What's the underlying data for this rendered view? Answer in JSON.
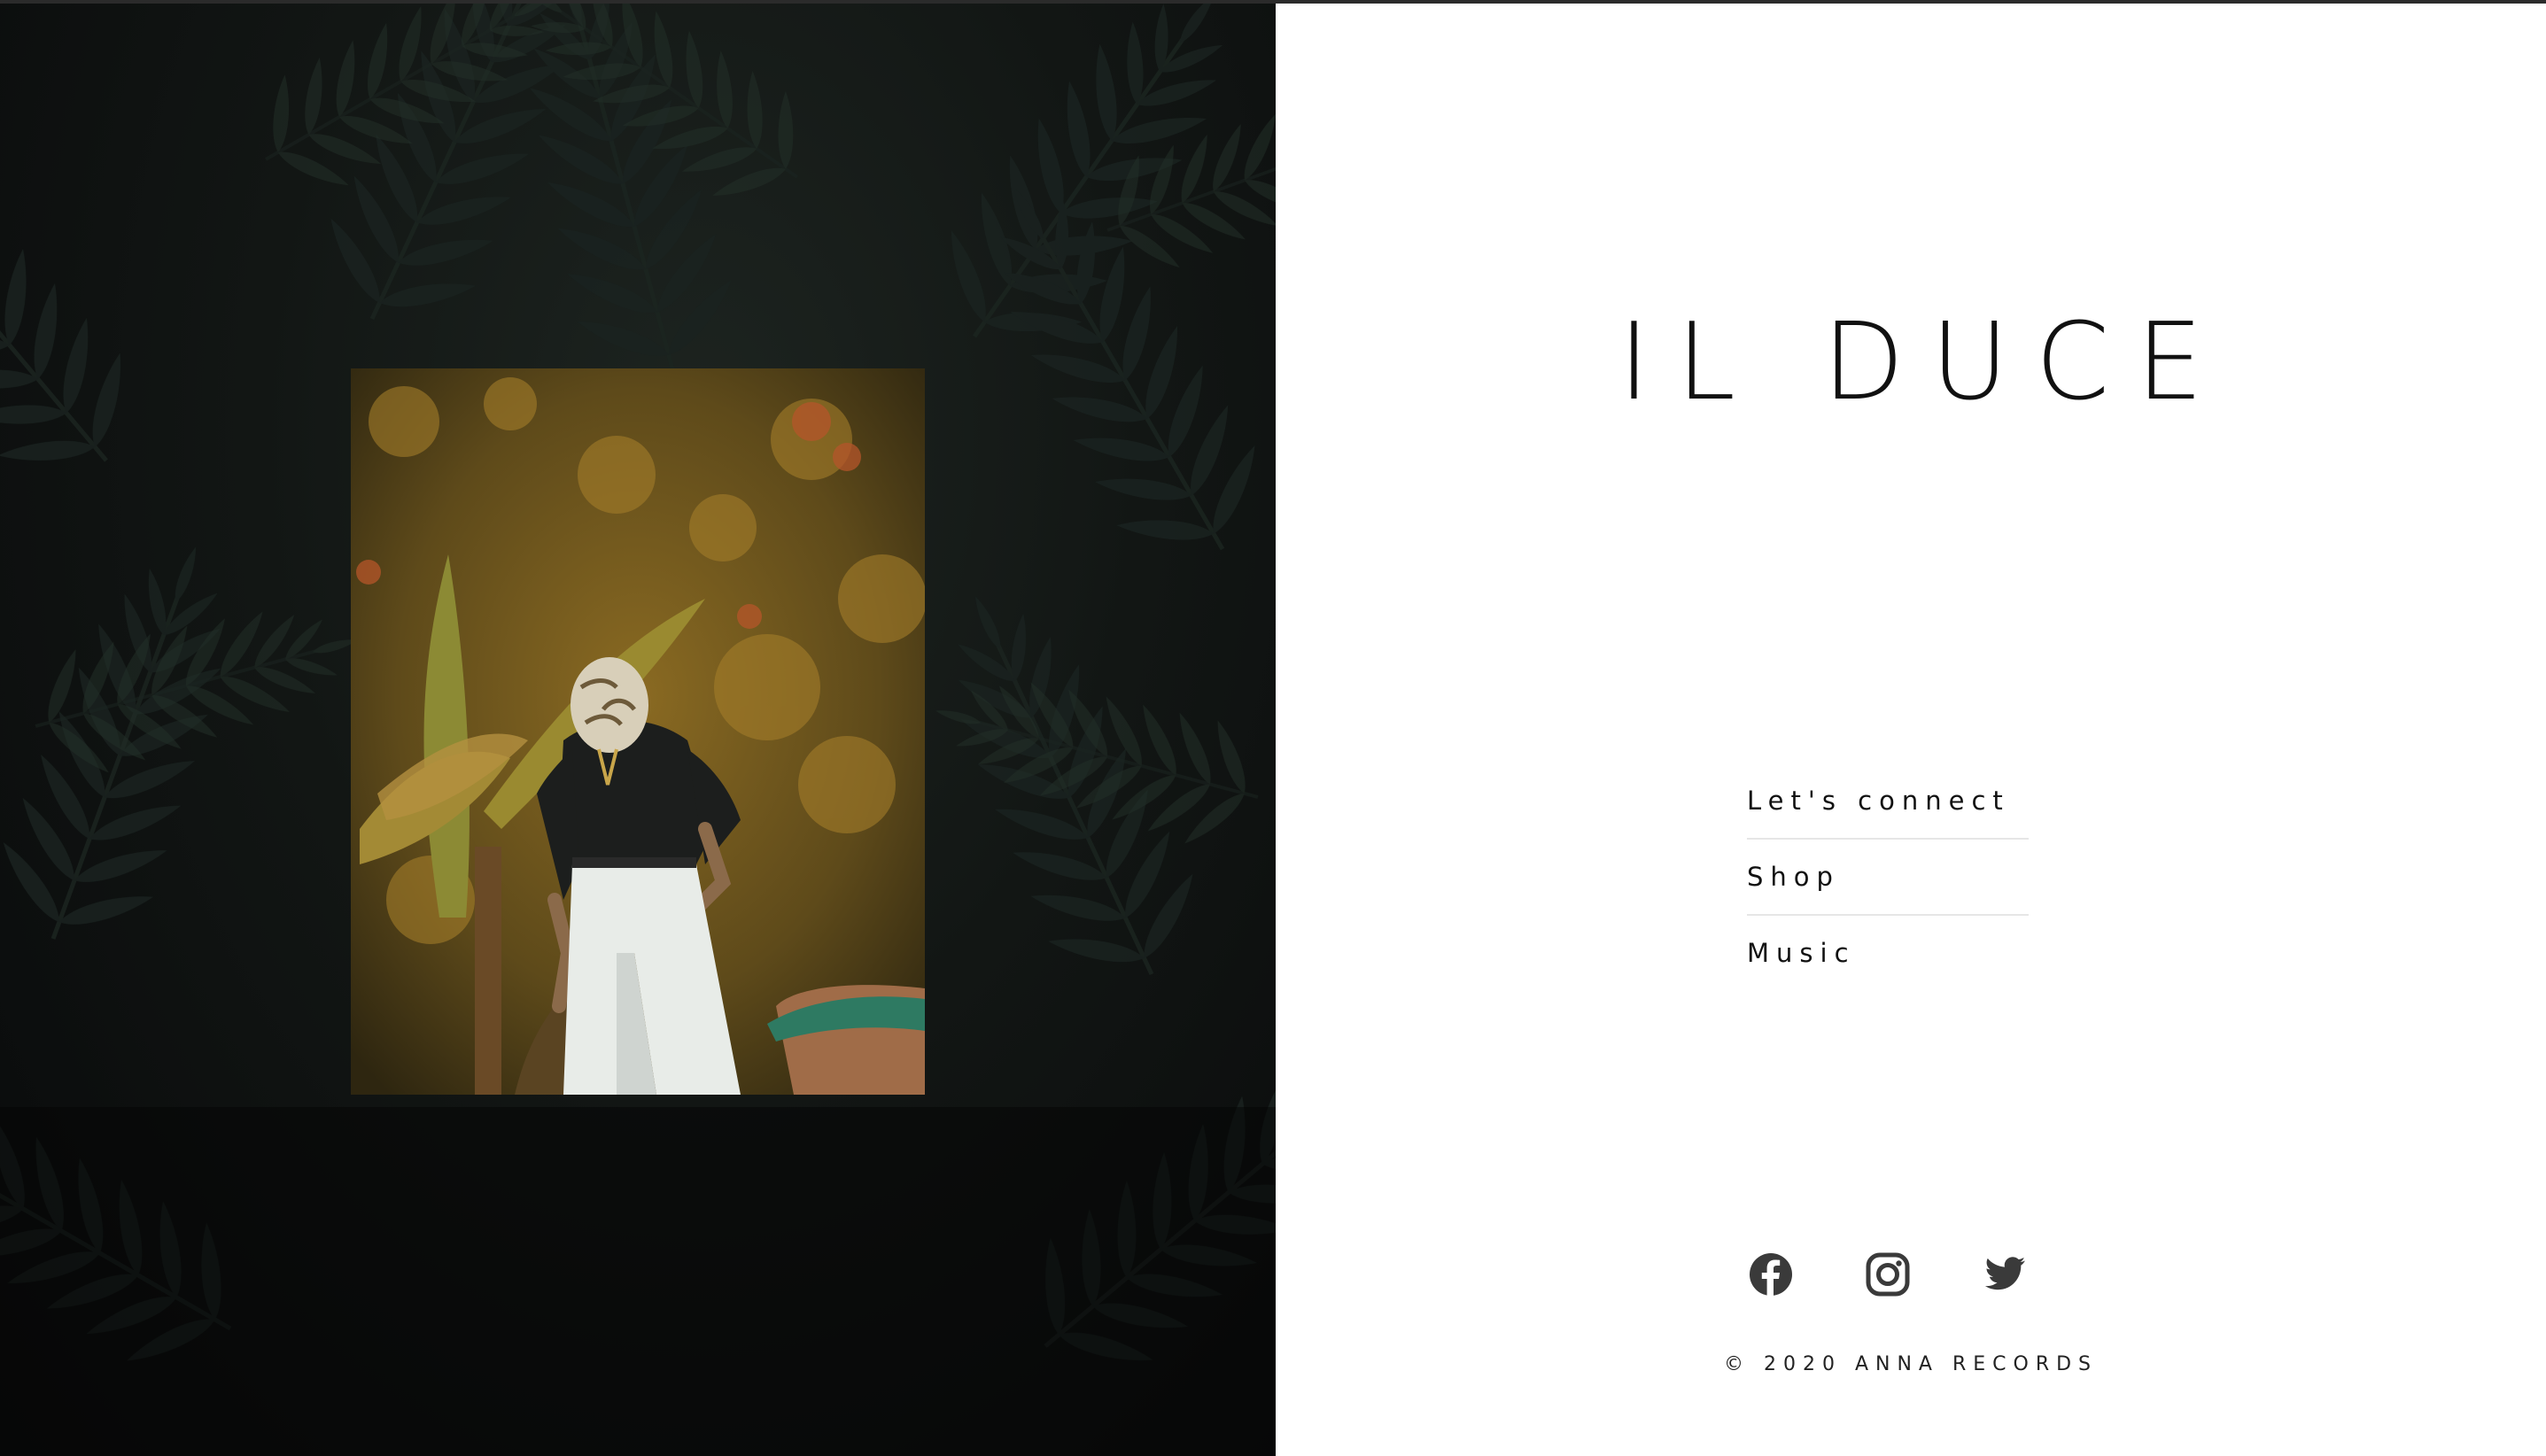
{
  "site": {
    "title": "IL DUCE"
  },
  "nav": {
    "items": [
      {
        "label": "Let's connect"
      },
      {
        "label": "Shop"
      },
      {
        "label": "Music"
      }
    ]
  },
  "social": {
    "items": [
      {
        "icon": "facebook-icon"
      },
      {
        "icon": "instagram-icon"
      },
      {
        "icon": "twitter-icon"
      }
    ]
  },
  "footer": {
    "copyright": "© 2020 ANNA RECORDS"
  },
  "colors": {
    "text": "#111111",
    "icon": "#3a3a3a",
    "left_bg": "#0e1110",
    "divider": "#e6e6e6"
  }
}
